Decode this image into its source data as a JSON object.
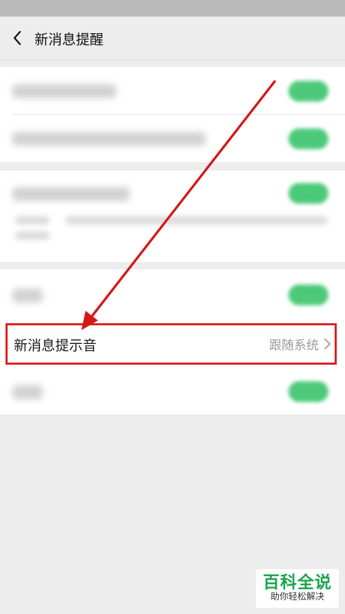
{
  "header": {
    "title": "新消息提醒",
    "back_icon": "chevron-left-icon"
  },
  "settings": {
    "sound_row": {
      "label": "新消息提示音",
      "value": "跟随系统"
    }
  },
  "annotation": {
    "box_color": "#e11b1b",
    "arrow_color": "#d41818"
  },
  "watermark": {
    "title": "百科全说",
    "subtitle": "助你轻松解决"
  },
  "colors": {
    "toggle_on": "#39c46b",
    "background": "#ededed"
  }
}
